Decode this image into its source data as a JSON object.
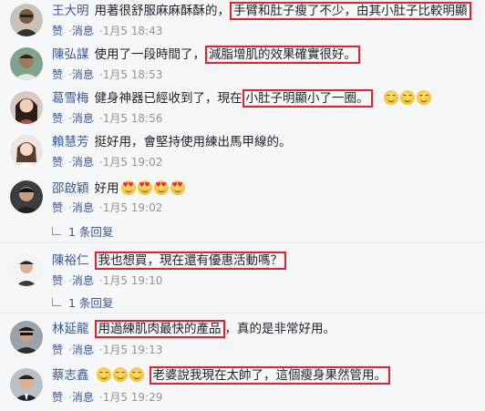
{
  "meta": {
    "like": "赞",
    "message": "消息",
    "separator": "·"
  },
  "comments": [
    {
      "name": "王大明",
      "before": "用著很舒服麻麻酥酥的，",
      "highlight": "手臂和肚子瘦了不少，由其小肚子比較明顯",
      "after": "",
      "time": "1月5 18:43",
      "avatar": "man-glasses"
    },
    {
      "name": "陳弘謀",
      "before": "使用了一段時間了，",
      "highlight": "減脂增肌的效果確實很好。",
      "after": "",
      "time": "1月5 18:53",
      "avatar": "man-outdoor"
    },
    {
      "name": "葛雪梅",
      "before": "健身神器已經收到了，現在",
      "highlight": "小肚子明顯小了一圈。",
      "after": "",
      "emojis": [
        "smile",
        "smile",
        "smile"
      ],
      "time": "1月5 18:56",
      "avatar": "woman-dark-hair"
    },
    {
      "name": "賴慧芳",
      "before": "挺好用，會堅持使用練出馬甲線的。",
      "time": "1月5 19:02",
      "avatar": "woman-light"
    },
    {
      "name": "邵啟穎",
      "before": "好用",
      "emojis": [
        "heart-eyes",
        "heart-eyes",
        "heart-eyes",
        "heart-eyes"
      ],
      "time": "1月5 19:02",
      "avatar": "man-dark"
    },
    {
      "name": "陳裕仁",
      "before": "",
      "highlight": "我也想買，現在還有優惠活動嗎？",
      "after": "",
      "time": "1月5 19:10",
      "avatar": "man-white-bg"
    },
    {
      "name": "林延龍",
      "before": "",
      "highlight": "用過練肌肉最快的產品",
      "after": "，真的是非常好用。",
      "time": "1月5 19:13",
      "avatar": "man-glasses-dark"
    },
    {
      "name": "蔡志鑫",
      "emojis_before": [
        "smile",
        "smile",
        "smile"
      ],
      "highlight": "老婆說我現在太帥了，這個瘦身果然管用。",
      "time": "1月5 19:29",
      "avatar": "man-suit"
    }
  ],
  "replies": [
    {
      "label": "1 条回复"
    },
    {
      "label": "1 条回复"
    }
  ],
  "colors": {
    "name": "#365899",
    "highlight_border": "#e8202a",
    "meta": "#90949c",
    "background": "#f6f7f9"
  }
}
